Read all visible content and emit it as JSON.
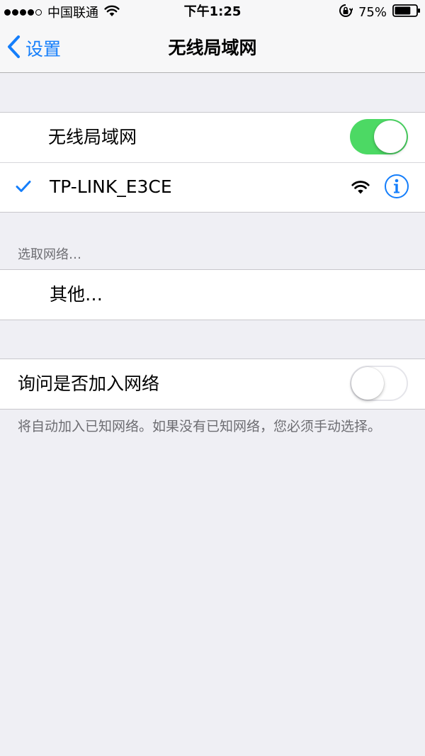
{
  "status_bar": {
    "carrier": "中国联通",
    "time": "下午1:25",
    "battery_percent": "75%",
    "signal_dots_filled": 4,
    "signal_dots_total": 5,
    "battery_level": 0.75
  },
  "nav": {
    "back_label": "设置",
    "title": "无线局域网"
  },
  "wifi_group": {
    "toggle_label": "无线局域网",
    "toggle_state": "on",
    "connected_network": "TP-LINK_E3CE"
  },
  "choose_network": {
    "header": "选取网络…",
    "other_label": "其他…"
  },
  "ask_group": {
    "label": "询问是否加入网络",
    "toggle_state": "off",
    "footer": "将自动加入已知网络。如果没有已知网络，您必须手动选择。"
  },
  "colors": {
    "accent": "#147efb",
    "toggle_on": "#4cd964",
    "background": "#efeff4",
    "secondary_text": "#6d6d72"
  },
  "icons": {
    "back": "chevron-left-icon",
    "check": "checkmark-icon",
    "wifi_strength": "wifi-icon",
    "info": "info-icon",
    "lock_rotation": "rotation-lock-icon",
    "battery": "battery-icon"
  }
}
